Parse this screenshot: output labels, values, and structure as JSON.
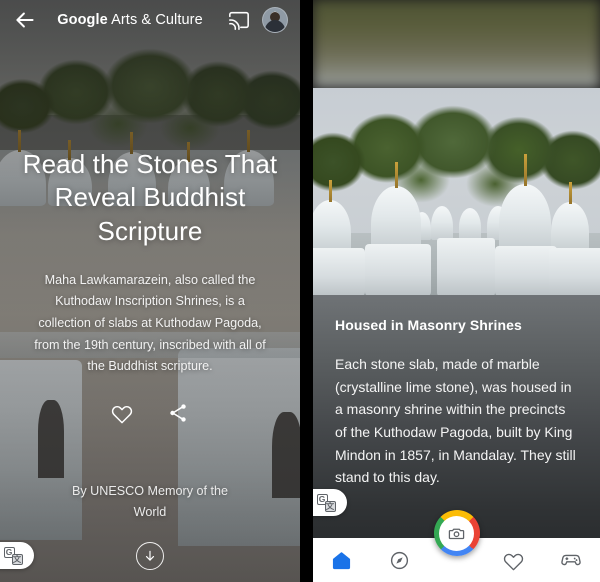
{
  "left_screen": {
    "header": {
      "back_icon": "back-arrow-icon",
      "brand_bold": "Google",
      "brand_rest": " Arts & Culture",
      "cast_icon": "cast-icon",
      "avatar": "user-avatar"
    },
    "hero": {
      "title": "Read the Stones That Reveal Buddhist Scripture",
      "description": "Maha Lawkamarazein, also called the Kuthodaw Inscription Shrines, is a collection of slabs at Kuthodaw Pagoda, from the 19th century, inscribed with all of the Buddhist scripture.",
      "favorite_icon": "heart-icon",
      "share_icon": "share-icon",
      "credit": "By UNESCO Memory of the World",
      "scroll_icon": "arrow-down-icon"
    },
    "translate_pill": {
      "icon": "google-translate-icon",
      "glyph_primary": "G",
      "glyph_secondary": "文"
    }
  },
  "right_screen": {
    "card": {
      "title": "Housed in Masonry Shrines",
      "body": "Each stone slab, made of marble (crystalline lime stone), was housed in a masonry shrine within the precincts of the Kuthodaw Pagoda, built by King Mindon in 1857, in Mandalay. They still stand to this day."
    },
    "translate_pill": {
      "icon": "google-translate-icon",
      "glyph_primary": "G",
      "glyph_secondary": "文"
    },
    "fab": {
      "icon": "camera-icon"
    },
    "navbar": {
      "items": [
        {
          "name": "home",
          "icon": "home-icon",
          "active": true
        },
        {
          "name": "explore",
          "icon": "compass-icon",
          "active": false
        },
        {
          "name": "favorites",
          "icon": "heart-icon",
          "active": false
        },
        {
          "name": "play",
          "icon": "gamepad-icon",
          "active": false
        }
      ],
      "active_color": "#1a73e8",
      "inactive_color": "#5f6368"
    }
  }
}
